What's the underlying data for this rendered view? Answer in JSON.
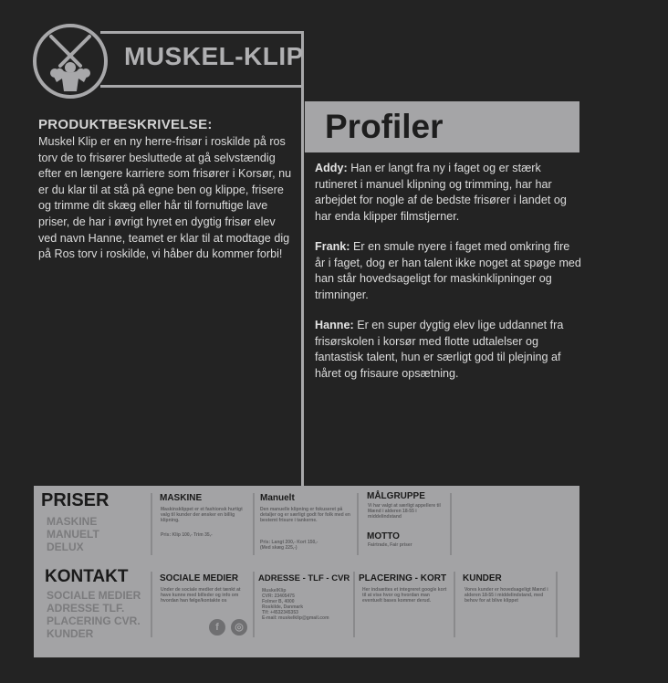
{
  "logo": {
    "text": "MUSKEL-KLIP"
  },
  "produkt": {
    "title": "PRODUKTBESKRIVELSE:",
    "body": "Muskel Klip er en ny herre-frisør i roskilde på ros torv de to frisører besluttede at gå selvstændig efter en længere karriere som frisører i Korsør, nu er du klar til at stå på egne ben og klippe, frisere og trimme dit skæg eller hår til fornuftige lave priser, de har i øvrigt hyret en dygtig frisør elev ved navn Hanne, teamet er klar til at modtage dig på Ros torv i roskilde, vi håber du kommer forbi!"
  },
  "profiler": {
    "title": "Profiler",
    "items": [
      {
        "name": "Addy:",
        "text": "Han er langt fra ny i faget og er stærk rutineret i manuel klipning og trimming, har har arbejdet for nogle af de bedste frisører i landet og har enda klipper filmstjerner."
      },
      {
        "name": "Frank:",
        "text": "Er en smule nyere i faget med omkring fire år i faget, dog er han talent ikke noget at spøge med han står hovedsageligt for maskinklipninger og trimninger."
      },
      {
        "name": "Hanne:",
        "text": "Er en super dygtig elev lige uddannet fra frisørskolen i korsør med flotte udtalelser og fantastisk talent, hun er særligt god til plejning af håret og frisaure opsætning."
      }
    ]
  },
  "panel": {
    "priser": {
      "title": "PRISER",
      "items": [
        "MASKINE",
        "MANUELT",
        "DELUX"
      ]
    },
    "kontakt": {
      "title": "KONTAKT",
      "items": [
        "SOCIALE MEDIER",
        "ADRESSE TLF.",
        "PLACERING CVR.",
        "KUNDER"
      ]
    },
    "maskine": {
      "title": "MASKINE",
      "text": "Maskinsklippet er et fashionsk hurtigt valg til kunder der ønsker en billig klipning.",
      "price": "Pris: Klip 100,-   Trim 35,-"
    },
    "manuelt": {
      "title": "Manuelt",
      "text": "Den manuelle klipning er fokuseret på detaljer og er særligt godt for folk med en bestemt frisure i tankerne.",
      "price": "Pris: Langt 200,-   Kort 150,-\n(Med skæg 225,-)"
    },
    "malgruppe": {
      "title": "MÅLGRUPPE",
      "text": "Vi har valgt at særligt appellere til Mænd i alderen 18-55 i middelindstand"
    },
    "motto": {
      "title": "MOTTO",
      "text": "Fairtrade, Fair priser"
    },
    "sociale": {
      "title": "SOCIALE MEDIER",
      "text": "Under de sociale medier det tænkt at have kunne med billeder og info om hvordan han følge/kontakte os",
      "fb": "f",
      "ig": "◎"
    },
    "adresse": {
      "title": "ADRESSE - TLF - CVR",
      "text": "MuskelKlip\nCVR: 23405475\nFolmer B, 4000\nRoskilde, Danmark\nTlf: +4532345353\nE-mail: muskelklip@gmail.com"
    },
    "placering": {
      "title": "PLACERING - KORT",
      "text": "Her indsættes et integreret google kort til at vise hvor og hvordan man eventuelt bases kommer derud."
    },
    "kunder": {
      "title": "KUNDER",
      "text": "Vores kunder er hovedsageligt Mænd i alderen 18-55 i middelindstand, med behov for at blive klippet"
    }
  },
  "colors": {
    "background": "#232323",
    "panel": "#a3a3a5",
    "accent": "#a8a8aa"
  },
  "icons": [
    "scissors-bodybuilder-logo-icon",
    "facebook-icon",
    "instagram-icon"
  ]
}
